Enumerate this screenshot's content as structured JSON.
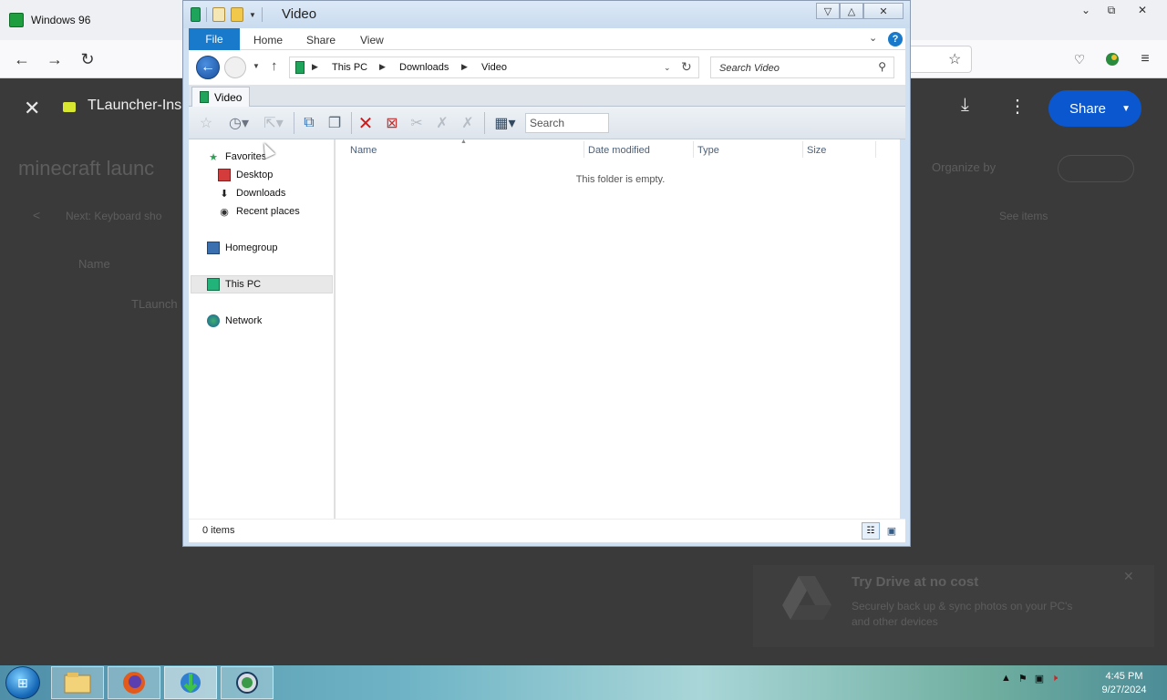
{
  "browser": {
    "tab_title": "Windows 96",
    "window_controls": {
      "minimize": "⌄",
      "restore": "⧉",
      "close": "✕"
    }
  },
  "drive_preview": {
    "file_title": "TLauncher-Ins",
    "share_label": "Share",
    "folder_heading": "minecraft launc",
    "layout_label": "Organize by",
    "breadcrumb_hint": "Next: Keyboard sho",
    "see_info": "See items",
    "col_name": "Name",
    "row_name": "TLaunch",
    "promo_title": "Try Drive at no cost",
    "promo_body_1": "Securely back up & sync photos on your PC's",
    "promo_body_2": "and other devices"
  },
  "explorer": {
    "title": "Video",
    "ribbon_tabs": {
      "file": "File",
      "home": "Home",
      "share": "Share",
      "view": "View"
    },
    "breadcrumbs": [
      "This PC",
      "Downloads",
      "Video"
    ],
    "search_placeholder": "Search Video",
    "folder_tab": "Video",
    "toolbar_search_placeholder": "Search",
    "nav": {
      "favorites": "Favorites",
      "desktop": "Desktop",
      "downloads": "Downloads",
      "recent_places": "Recent places",
      "homegroup": "Homegroup",
      "this_pc": "This PC",
      "network": "Network"
    },
    "columns": {
      "name": "Name",
      "date_modified": "Date modified",
      "type": "Type",
      "size": "Size"
    },
    "empty_message": "This folder is empty.",
    "status": {
      "item_count": "0 items"
    }
  },
  "taskbar": {
    "time": "4:45 PM",
    "date": "9/27/2024"
  },
  "colors": {
    "ribbon_file_tab": "#1979ca",
    "drive_share_button": "#0b57d0",
    "taskbar_gradient_mid": "#a9d6d8"
  },
  "icons": [
    "windows96-favicon",
    "back-arrow-icon",
    "forward-arrow-icon",
    "reload-icon",
    "pocket-icon",
    "extension-icon",
    "menu-icon",
    "close-icon",
    "download-icon",
    "more-vert-icon",
    "folder-icon",
    "ribbon-expand-icon",
    "help-icon",
    "up-arrow-icon",
    "refresh-icon",
    "search-icon",
    "star-icon",
    "clock-icon",
    "delete-icon",
    "view-layout-icon",
    "start-orb-icon",
    "explorer-icon",
    "firefox-icon",
    "ie-icon",
    "network-globe-icon",
    "flag-icon",
    "volume-icon"
  ]
}
